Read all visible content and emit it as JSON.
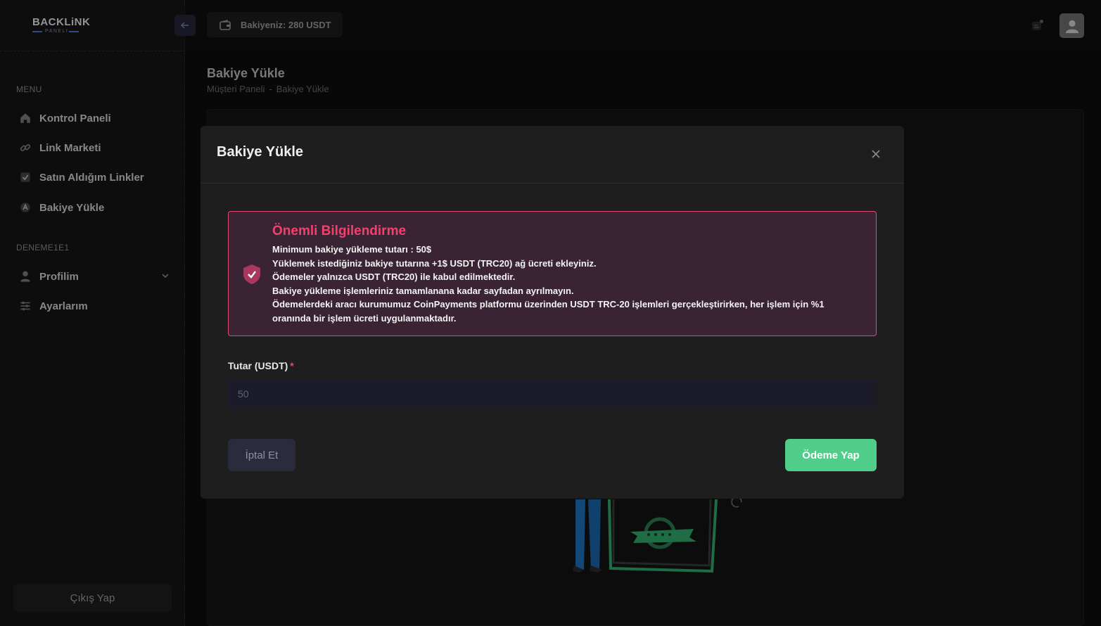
{
  "brand": {
    "name": "BACKLiNK",
    "sub": "PANELİ"
  },
  "sidebar": {
    "menu_title": "MENU",
    "items": [
      {
        "label": "Kontrol Paneli",
        "icon": "home-icon"
      },
      {
        "label": "Link Marketi",
        "icon": "link-icon"
      },
      {
        "label": "Satın Aldığım Linkler",
        "icon": "check-square-icon"
      },
      {
        "label": "Bakiye Yükle",
        "icon": "wallet-icon"
      }
    ],
    "account_title": "DENEME1E1",
    "account_items": [
      {
        "label": "Profilim",
        "icon": "user-icon"
      },
      {
        "label": "Ayarlarım",
        "icon": "sliders-icon"
      }
    ],
    "logout_label": "Çıkış Yap"
  },
  "header": {
    "balance_label": "Bakiyeniz: 280 USDT"
  },
  "page": {
    "title": "Bakiye Yükle",
    "breadcrumb": [
      "Müşteri Paneli",
      "-",
      "Bakiye Yükle"
    ]
  },
  "modal": {
    "title": "Bakiye Yükle",
    "notice": {
      "title": "Önemli Bilgilendirme",
      "lines": [
        "Minimum bakiye yükleme tutarı : 50$",
        "Yüklemek istediğiniz bakiye tutarına +1$ USDT (TRC20) ağ ücreti ekleyiniz.",
        "Ödemeler yalnızca USDT (TRC20) ile kabul edilmektedir.",
        "Bakiye yükleme işlemleriniz tamamlanana kadar sayfadan ayrılmayın.",
        "Ödemelerdeki aracı kurumumuz CoinPayments platformu üzerinden USDT TRC-20 işlemleri gerçekleştirirken, her işlem için %1",
        "oranında bir işlem ücreti uygulanmaktadır."
      ]
    },
    "amount_label": "Tutar (USDT)",
    "amount_required": "*",
    "amount_placeholder": "50",
    "cancel_label": "İptal Et",
    "pay_label": "Ödeme Yap"
  },
  "colors": {
    "accent_green": "#50cd89",
    "danger": "#f1416c",
    "primary": "#3d73d9"
  }
}
